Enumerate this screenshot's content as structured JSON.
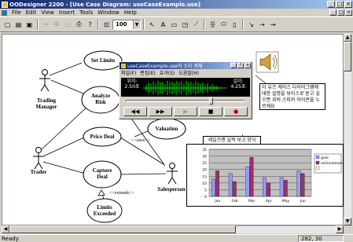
{
  "window": {
    "title": "OODesigner 2200 - [Use Case Diagram: useCaseExample.use]",
    "controls": [
      "_",
      "□",
      "×"
    ]
  },
  "menu": {
    "items": [
      "File",
      "Edit",
      "View",
      "Insert",
      "Tools",
      "Window",
      "Help"
    ],
    "mdi_controls": [
      "_",
      "□",
      "×"
    ]
  },
  "toolbar": {
    "zoom_value": "100"
  },
  "diagram": {
    "actors": {
      "trading_manager": "Trading Manager",
      "trader": "Trader",
      "salesperson": "Salesperson"
    },
    "use_cases": {
      "set_limits": "Set Limits",
      "analyze_risk": "Analyze Risk",
      "price_deal": "Price Deal",
      "valuation": "Valuation",
      "capture_deal": "Capture Deal",
      "limits_exceeded": "Limits Exceeded"
    },
    "stereotypes": {
      "uses": "<<uses>>",
      "extends": "<<extends>>"
    }
  },
  "player": {
    "title": "useCaseExample.use의 소리 개체",
    "menu": [
      "파일(F)",
      "편집(E)",
      "효과(S)",
      "도움말(H)"
    ],
    "position_label": "위치:",
    "position_value": "2.50초",
    "length_label": "길이:",
    "length_value": "4.25초",
    "controls": [
      "◀◀",
      "▶▶",
      "▶",
      "■",
      "●"
    ],
    "seek_fraction": 0.75
  },
  "callouts": {
    "help_text": "이 유즈 케이스 다이어그램에 대한 설명을 보이스로 듣고 싶으면 위의 스피커 아이콘을 누르세요",
    "chart_caption": "세일즈맨 실적 보고 양식"
  },
  "chart_data": {
    "type": "bar",
    "categories": [
      "Jan",
      "Feb",
      "Mar",
      "Apr",
      "May",
      "Jun"
    ],
    "series": [
      {
        "name": "goal",
        "values": [
          13,
          17,
          22,
          14,
          14,
          19
        ]
      },
      {
        "name": "achievement",
        "values": [
          19,
          11,
          29,
          10,
          12,
          17
        ]
      },
      {
        "name": "",
        "values": [
          0,
          0,
          0,
          0,
          0,
          0
        ]
      }
    ],
    "yticks": [
      "0",
      "5",
      "10",
      "15",
      "20",
      "25",
      "30",
      "35"
    ],
    "ylim": [
      0,
      35
    ],
    "grid": true,
    "legend": "right",
    "colors": [
      "#9999ff",
      "#993366",
      "#ffffcc"
    ]
  },
  "statusbar": {
    "text": "Ready",
    "coords": "282,  30"
  }
}
